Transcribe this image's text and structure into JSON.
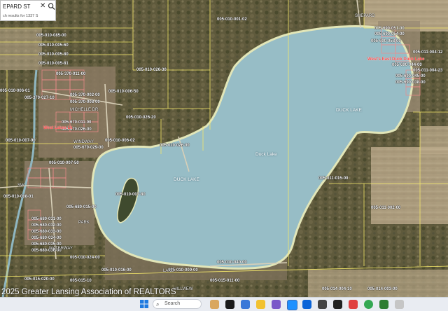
{
  "search": {
    "value": "EPARD ST",
    "hint": "ch results for 1337 S",
    "close_symbol": "✕"
  },
  "lake_labels": {
    "center": "Duck Lake",
    "east": "DUCK LAKE",
    "west": "DUCK LAKE"
  },
  "street_labels": [
    "MICHELLE DR",
    "LAKE",
    "WATERWAY",
    "SW",
    "PARK",
    "WINDWAY",
    "HILLVIEW",
    "SHEPARD"
  ],
  "red_labels": {
    "west_lakes": "West Lakes Lk",
    "east_lake": "West's East Duck Duck Lake"
  },
  "parcels": [
    "005-010-001-02",
    "005-010-085-00",
    "005-010-005-60",
    "005-010-005-80",
    "005-010-005-81",
    "005-010-026-30",
    "005-010-006-50",
    "005-370-011-00",
    "005-370-027-10",
    "005-370-002-00",
    "005-370-008-00",
    "005-010-006-01",
    "005-670-011-00",
    "005-670-026-00",
    "005-670-029-00",
    "005-010-026-20",
    "005-010-006-02",
    "005-010-026-00",
    "005-010-007-50",
    "005-010-007-90",
    "005-010-008-01",
    "005-680-015-00",
    "005-680-031-00",
    "005-680-032-00",
    "005-680-033-00",
    "005-680-034-00",
    "005-680-035-00",
    "005-680-036-00",
    "005-010-007-80",
    "005-010-024-00",
    "005-010-016-00",
    "005-015-020-00",
    "005-015-10",
    "005-015-011-00",
    "005-010-009-00",
    "005-690-051-00",
    "005-690-054-00",
    "005-690-058-00",
    "005-011-004-12",
    "005-011-004-23",
    "005-690-044-00",
    "005-690-045-00",
    "005-690-038-00",
    "005-011-015-00",
    "005-011-002-00",
    "005-014-004-10",
    "005-014-003-00",
    "005-010-040-00"
  ],
  "copyright": "2025 Greater Lansing Association of REALTORS",
  "taskbar": {
    "search_label": "Search",
    "colors": {
      "start": "#1f7ae0",
      "edge": "#1e90ff",
      "chrome": "#34a853",
      "mail": "#0a64d8",
      "store": "#444444",
      "files": "#f2c230",
      "amazon": "#222222",
      "red": "#e04040"
    }
  }
}
